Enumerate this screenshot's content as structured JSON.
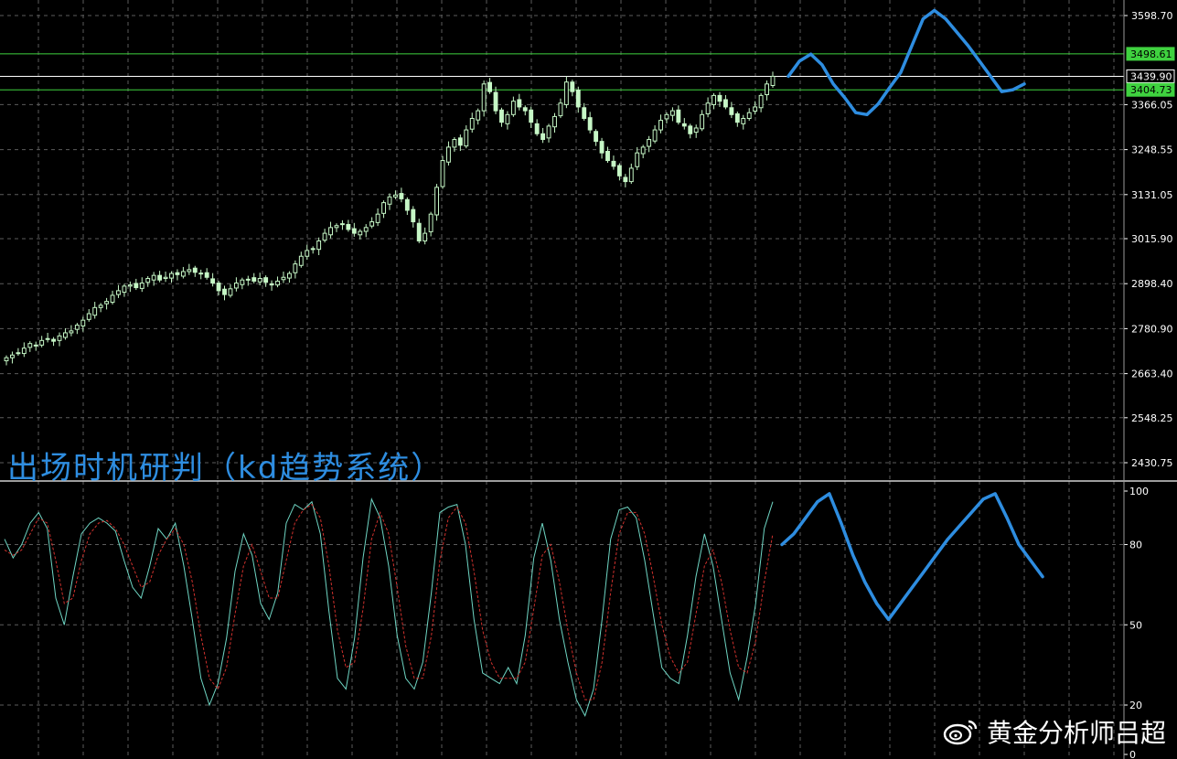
{
  "chart_data": [
    {
      "type": "candlestick",
      "panel": "price",
      "y_ticks": [
        "3598.70",
        "3366.05",
        "3248.55",
        "3131.05",
        "3015.90",
        "2898.40",
        "2780.90",
        "2663.40",
        "2548.25",
        "2430.75"
      ],
      "price_labels": [
        {
          "value": "3498.61",
          "color": "#3fd23f"
        },
        {
          "value": "3439.90",
          "color": "#ffffff"
        },
        {
          "value": "3404.73",
          "color": "#3fd23f"
        }
      ],
      "horizontal_lines": [
        3498.61,
        3439.9,
        3404.73
      ],
      "grid": true,
      "candle_color": "#c6f7c6",
      "closes": [
        2705,
        2712,
        2718,
        2730,
        2742,
        2738,
        2750,
        2755,
        2748,
        2762,
        2770,
        2775,
        2790,
        2803,
        2820,
        2836,
        2842,
        2852,
        2868,
        2880,
        2892,
        2895,
        2888,
        2900,
        2912,
        2920,
        2908,
        2915,
        2925,
        2922,
        2930,
        2935,
        2928,
        2925,
        2915,
        2900,
        2880,
        2870,
        2885,
        2900,
        2908,
        2910,
        2905,
        2912,
        2902,
        2895,
        2905,
        2915,
        2925,
        2950,
        2970,
        2985,
        2990,
        3010,
        3030,
        3045,
        3050,
        3055,
        3040,
        3030,
        3035,
        3045,
        3060,
        3080,
        3110,
        3125,
        3130,
        3120,
        3090,
        3060,
        3010,
        3030,
        3080,
        3150,
        3220,
        3255,
        3275,
        3260,
        3300,
        3330,
        3350,
        3420,
        3400,
        3350,
        3320,
        3340,
        3375,
        3360,
        3350,
        3320,
        3290,
        3275,
        3310,
        3335,
        3370,
        3425,
        3400,
        3360,
        3330,
        3300,
        3270,
        3240,
        3220,
        3205,
        3180,
        3165,
        3200,
        3240,
        3255,
        3275,
        3300,
        3325,
        3340,
        3350,
        3320,
        3310,
        3290,
        3305,
        3340,
        3370,
        3390,
        3375,
        3360,
        3340,
        3320,
        3330,
        3345,
        3360,
        3390,
        3420,
        3440
      ],
      "drawn_path_note": "",
      "blue_path_y": [
        3440,
        3480,
        3498,
        3470,
        3420,
        3385,
        3345,
        3340,
        3368,
        3410,
        3450,
        3520,
        3590,
        3612,
        3590,
        3555,
        3520,
        3480,
        3440,
        3400,
        3405,
        3420
      ]
    },
    {
      "type": "line",
      "panel": "oscillator",
      "y_ticks": [
        "100",
        "80",
        "50",
        "20",
        "0"
      ],
      "ylim": [
        0,
        100
      ],
      "grid": true,
      "series": [
        {
          "color": "#6fd6c4",
          "values": [
            82,
            75,
            80,
            88,
            92,
            86,
            60,
            50,
            68,
            84,
            88,
            90,
            88,
            85,
            74,
            64,
            60,
            72,
            86,
            82,
            88,
            72,
            52,
            30,
            20,
            28,
            45,
            70,
            84,
            76,
            58,
            52,
            62,
            88,
            95,
            93,
            96,
            84,
            55,
            30,
            26,
            45,
            75,
            97,
            90,
            72,
            46,
            30,
            26,
            36,
            62,
            92,
            94,
            95,
            80,
            52,
            32,
            30,
            28,
            34,
            28,
            46,
            75,
            88,
            74,
            52,
            36,
            22,
            16,
            26,
            52,
            82,
            93,
            94,
            90,
            74,
            54,
            34,
            30,
            28,
            46,
            68,
            84,
            72,
            52,
            32,
            22,
            38,
            58,
            86,
            96
          ]
        },
        {
          "color": "#d0312d",
          "values": [
            78,
            76,
            78,
            84,
            90,
            88,
            74,
            58,
            60,
            74,
            84,
            88,
            89,
            86,
            80,
            72,
            64,
            66,
            76,
            82,
            86,
            80,
            66,
            46,
            30,
            26,
            34,
            54,
            72,
            80,
            70,
            60,
            60,
            74,
            88,
            93,
            95,
            90,
            72,
            48,
            34,
            36,
            56,
            82,
            92,
            84,
            64,
            42,
            30,
            30,
            46,
            74,
            90,
            94,
            88,
            70,
            48,
            36,
            30,
            30,
            30,
            36,
            56,
            76,
            80,
            66,
            48,
            32,
            22,
            22,
            36,
            62,
            84,
            92,
            92,
            84,
            68,
            50,
            38,
            32,
            36,
            54,
            72,
            78,
            66,
            48,
            34,
            32,
            44,
            66,
            84
          ]
        }
      ],
      "blue_path_y": [
        80,
        84,
        90,
        96,
        99,
        88,
        76,
        66,
        58,
        52,
        58,
        64,
        70,
        76,
        82,
        87,
        92,
        97,
        99,
        90,
        80,
        74,
        68
      ]
    }
  ],
  "overlay_title": "出场时机研判（kd趋势系统）",
  "watermark": {
    "text": "黄金分析师吕超",
    "logo": "weibo-icon"
  },
  "colors": {
    "grid": "#5c5c5c",
    "drawn": "#2e8de0",
    "axis_text": "#ffffff",
    "accent_line": "#3fd23f"
  }
}
